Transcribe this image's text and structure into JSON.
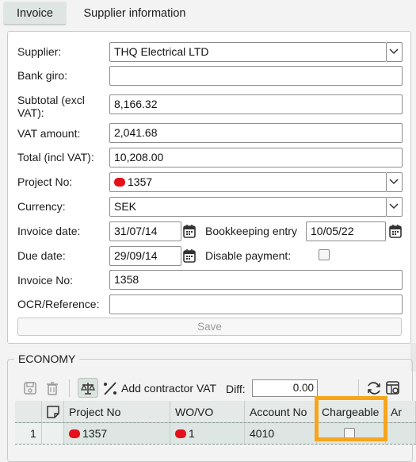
{
  "tabs": [
    {
      "label": "Invoice",
      "active": true
    },
    {
      "label": "Supplier information",
      "active": false
    }
  ],
  "form": {
    "supplier": {
      "label": "Supplier:",
      "value": "THQ Electrical LTD"
    },
    "bank_giro": {
      "label": "Bank giro:",
      "value": ""
    },
    "subtotal": {
      "label_line1": "Subtotal (excl",
      "label_line2": "VAT):",
      "value": "8,166.32"
    },
    "vat_amount": {
      "label": "VAT amount:",
      "value": "2,041.68"
    },
    "total": {
      "label": "Total (incl VAT):",
      "value": "10,208.00"
    },
    "project_no": {
      "label": "Project No:",
      "value": "1357",
      "status_color": "#e5101b"
    },
    "currency": {
      "label": "Currency:",
      "value": "SEK"
    },
    "invoice_date": {
      "label": "Invoice date:",
      "value": "31/07/14"
    },
    "bookkeeping_entry": {
      "label": "Bookkeeping entry",
      "value": "10/05/22"
    },
    "due_date": {
      "label": "Due date:",
      "value": "29/09/14"
    },
    "disable_payment": {
      "label": "Disable payment:",
      "checked": false
    },
    "invoice_no": {
      "label": "Invoice No:",
      "value": "1358"
    },
    "ocr_reference": {
      "label": "OCR/Reference:",
      "value": ""
    },
    "save_label": "Save"
  },
  "economy": {
    "title": "ECONOMY",
    "toolbar": {
      "add_contractor_vat": "Add contractor VAT",
      "diff_label": "Diff:",
      "diff_value": "0.00"
    },
    "columns": [
      "",
      "",
      "Project No",
      "WO/VO",
      "Account No",
      "Chargeable",
      "Ar"
    ],
    "rows": [
      {
        "index": "1",
        "project_no": "1357",
        "wo_vo": "1",
        "account_no": "4010",
        "chargeable": false
      }
    ]
  },
  "colors": {
    "status_red": "#e5101b",
    "highlight": "#f7a51b",
    "tab_active_bg": "#dfe5e2"
  }
}
